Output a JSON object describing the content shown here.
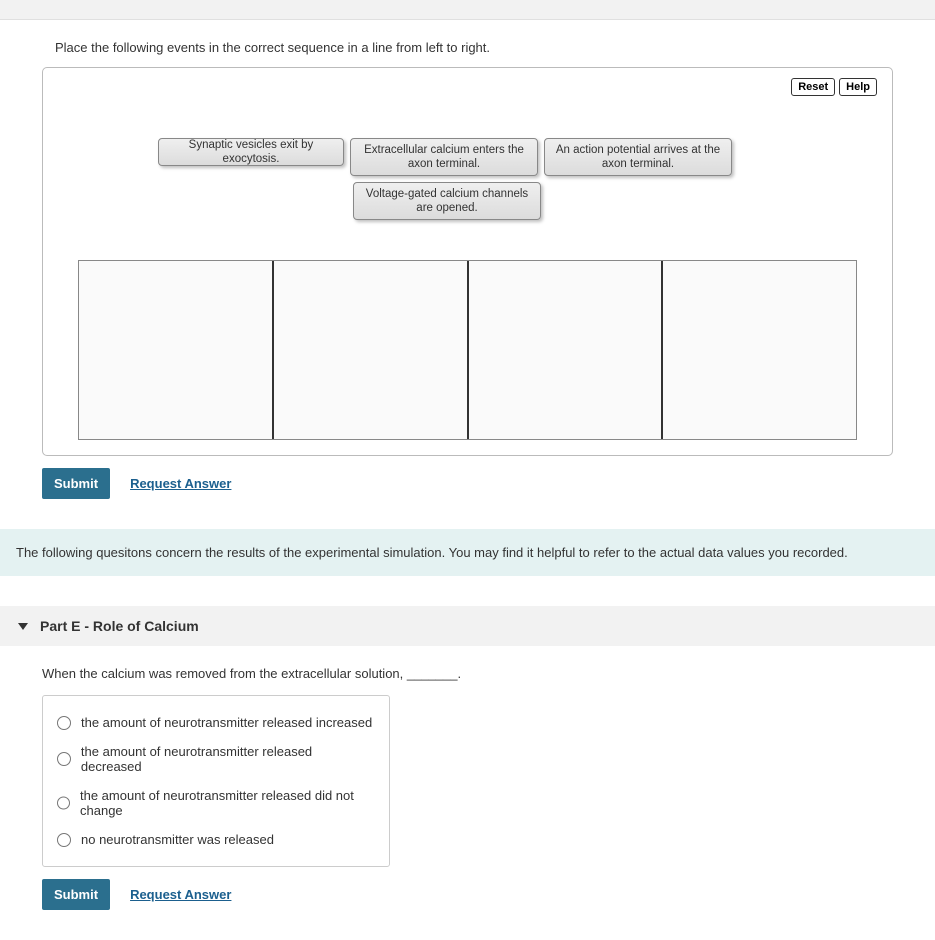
{
  "partD": {
    "instruction": "Place the following events in the correct sequence in a line from left to right.",
    "reset_label": "Reset",
    "help_label": "Help",
    "tiles": {
      "t1": "Synaptic vesicles exit by exocytosis.",
      "t2": "Extracellular calcium enters the axon terminal.",
      "t3": "An action potential arrives at the axon terminal.",
      "t4": "Voltage-gated calcium channels are opened."
    },
    "submit_label": "Submit",
    "request_label": "Request Answer"
  },
  "info_banner": "The following quesitons concern the results of the experimental simulation.  You may find it helpful to refer to the actual data values you recorded.",
  "partE": {
    "title": "Part E - Role of Calcium",
    "question": "When the calcium was removed from the extracellular solution, _______.",
    "options": {
      "o1": "the amount of neurotransmitter released increased",
      "o2": "the amount of neurotransmitter released decreased",
      "o3": "the amount of neurotransmitter released did not change",
      "o4": "no neurotransmitter was released"
    },
    "submit_label": "Submit",
    "request_label": "Request Answer"
  }
}
